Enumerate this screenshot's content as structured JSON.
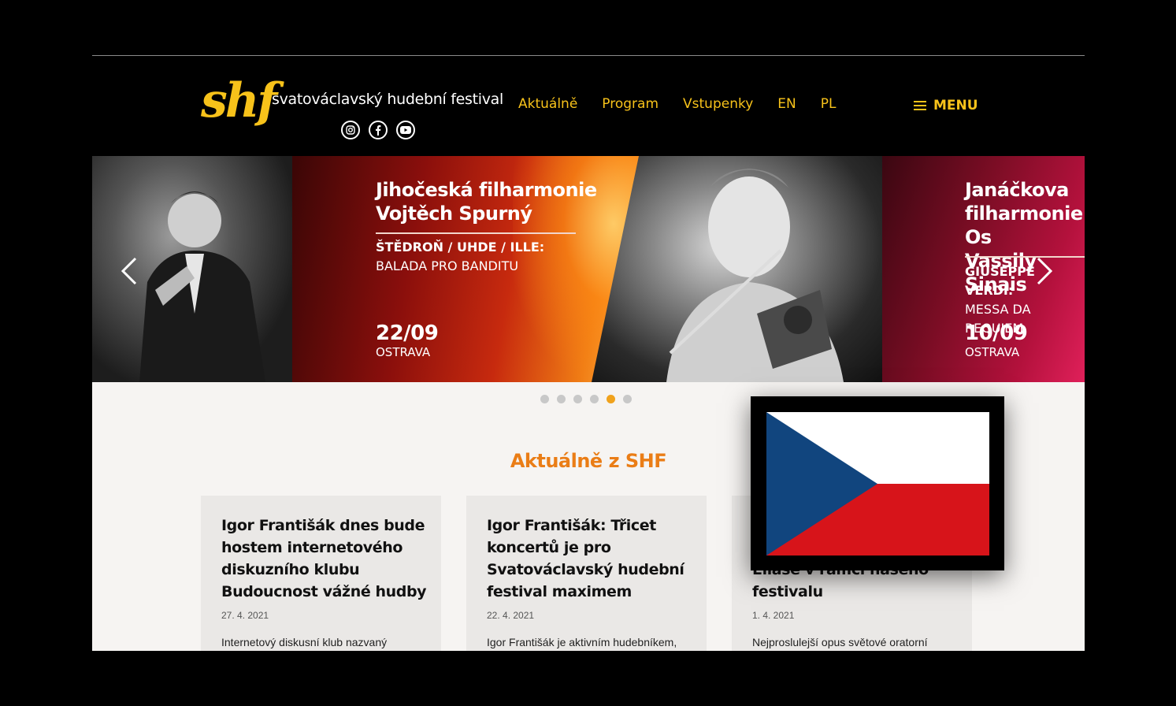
{
  "header": {
    "logo_mark": "shf",
    "logo_text": "svatováclavský hudební festival",
    "socials": [
      "instagram-icon",
      "facebook-icon",
      "youtube-icon"
    ],
    "nav": [
      "Aktuálně",
      "Program",
      "Vstupenky",
      "EN",
      "PL"
    ],
    "menu_label": "MENU"
  },
  "carousel": {
    "slide_main": {
      "title_line1": "Jihočeská filharmonie",
      "title_line2": "Vojtěch Spurný",
      "subtitle_line1": "ŠTĚDROŇ / UHDE / ILLE:",
      "subtitle_line2": "BALADA PRO BANDITU",
      "date": "22/09",
      "city": "OSTRAVA"
    },
    "slide_next": {
      "title_line1": "Janáčkova",
      "title_line2": "filharmonie Os",
      "title_line3": "Vassily Sinais",
      "subtitle_line1": "GIUSEPPE VERDI:",
      "subtitle_line2": "MESSA DA REQUIEM",
      "date": "10/09",
      "city": "OSTRAVA"
    },
    "dots_count": 6,
    "active_dot": 5
  },
  "news": {
    "title": "Aktuálně z SHF",
    "cards": [
      {
        "title": "Igor Františák dnes bude hostem internetového diskuzního klubu Budoucnost vážné hudby",
        "date": "27. 4. 2021",
        "excerpt": "Internetový diskusní klub nazvaný"
      },
      {
        "title": "Igor Františák: Třicet koncertů je pro Svatováclavský hudební festival maximem",
        "date": "22. 4. 2021",
        "excerpt": "Igor Františák je aktivním hudebníkem,"
      },
      {
        "title": "Collegia 1704 nastudují Eliáše v rámci našeho festivalu",
        "date": "1. 4. 2021",
        "excerpt": "Nejproslulejší opus světové oratorní"
      }
    ]
  },
  "colors": {
    "accent_yellow": "#f7c21a",
    "accent_orange": "#ea7d16",
    "flag_blue": "#11457e",
    "flag_red": "#d7141a",
    "flag_white": "#ffffff"
  }
}
